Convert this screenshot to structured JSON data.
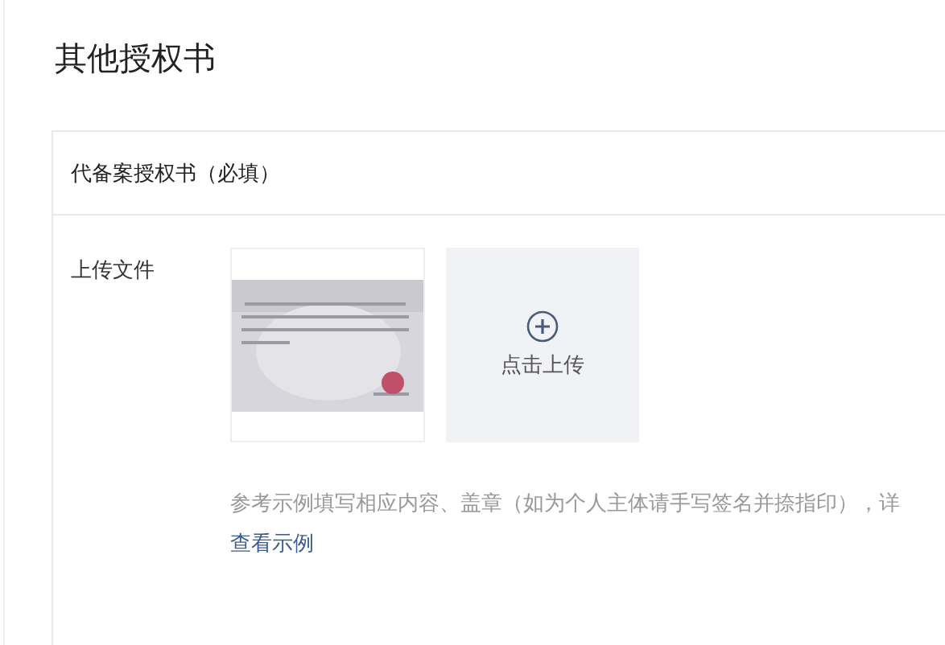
{
  "page_title": "其他授权书",
  "card": {
    "title": "代备案授权书（必填）",
    "field_label": "上传文件",
    "upload_button": {
      "label": "点击上传"
    },
    "hint": "参考示例填写相应内容、盖章（如为个人主体请手写签名并捺指印），详",
    "example_link": "查看示例"
  }
}
